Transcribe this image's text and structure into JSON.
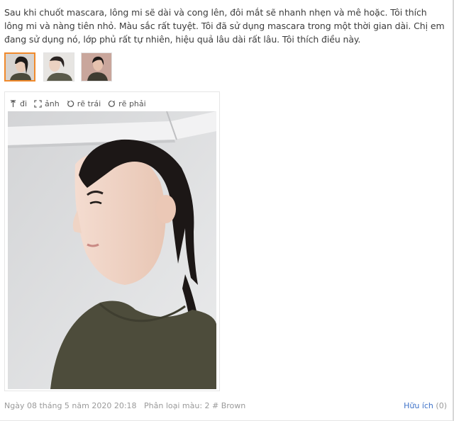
{
  "review": {
    "text": "Sau khi chuốt mascara, lông mi sẽ dài và cong lên, đôi mắt sẽ nhanh nhẹn và mê hoặc. Tôi thích lông mi và nàng tiên nhỏ. Màu sắc rất tuyệt. Tôi đã sử dụng mascara trong một thời gian dài. Chị em đang sử dụng nó, lớp phủ rất tự nhiên, hiệu quả lâu dài rất lâu. Tôi thích điều này."
  },
  "thumbnails": [
    {
      "name": "thumbnail-1",
      "selected": true
    },
    {
      "name": "thumbnail-2",
      "selected": false
    },
    {
      "name": "thumbnail-3",
      "selected": false
    }
  ],
  "toolbar": {
    "collapse_label": "đi",
    "fullscreen_label": "ảnh",
    "rotate_left_label": "rẽ trái",
    "rotate_right_label": "rẽ phải"
  },
  "footer": {
    "date": "Ngày 08 tháng 5 năm 2020 20:18",
    "variant": "Phân loại màu: 2 # Brown",
    "helpful_label": "Hữu ích",
    "helpful_count": "(0)"
  },
  "colors": {
    "accent": "#f08a2c",
    "link": "#3f73c9",
    "muted": "#9a9a9a"
  },
  "icons": [
    "up-arrow-icon",
    "fullscreen-icon",
    "rotate-left-icon",
    "rotate-right-icon"
  ]
}
